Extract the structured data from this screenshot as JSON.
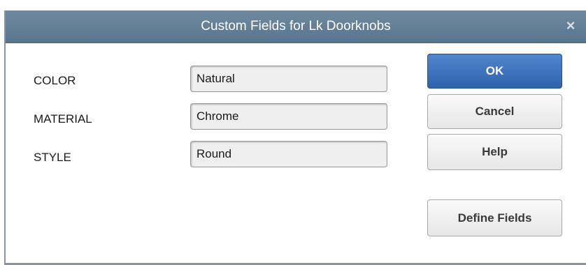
{
  "dialog": {
    "title": "Custom Fields for Lk Doorknobs",
    "close_glyph": "×"
  },
  "fields": [
    {
      "label": "COLOR",
      "value": "Natural"
    },
    {
      "label": "MATERIAL",
      "value": "Chrome"
    },
    {
      "label": "STYLE",
      "value": "Round"
    }
  ],
  "buttons": {
    "ok": "OK",
    "cancel": "Cancel",
    "help": "Help",
    "define_fields": "Define Fields"
  },
  "colors": {
    "titlebar": "#6f8aa0",
    "primary_button": "#3a70bb"
  },
  "icons": {
    "close": "close-icon"
  }
}
